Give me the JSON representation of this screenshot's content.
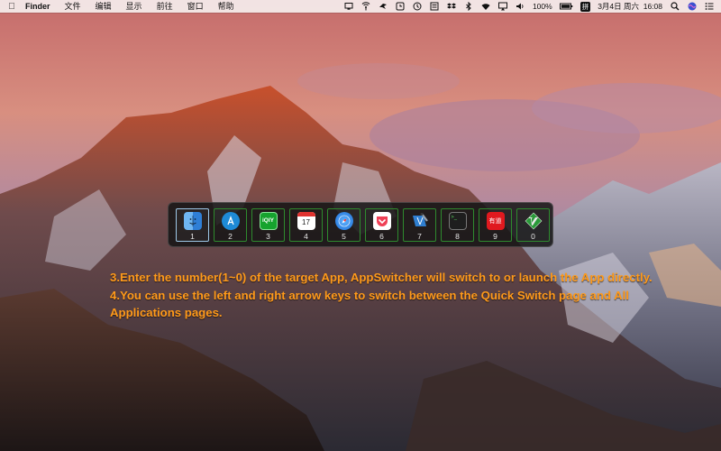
{
  "menubar": {
    "apple_icon": "apple-logo-icon",
    "app_name": "Finder",
    "menus": [
      "文件",
      "编辑",
      "显示",
      "前往",
      "窗口",
      "帮助"
    ],
    "status_icons": [
      "monitor-icon",
      "wifi-broadcast-icon",
      "bird-icon",
      "clock-icon",
      "timemachine-icon",
      "screen-icon",
      "dropbox-icon",
      "bluetooth-icon",
      "wifi-icon",
      "airplay-icon",
      "volume-icon"
    ],
    "battery_percent": "100%",
    "input_method": "拼",
    "datetime": "3月4日 周六  16:08",
    "search_icon": "search-icon",
    "user_icon": "siri-icon",
    "list_icon": "notification-list-icon"
  },
  "switcher": {
    "slots": [
      {
        "num": "1",
        "icon": "finder-icon",
        "bg": "#3b87d8",
        "selected": true
      },
      {
        "num": "2",
        "icon": "appstore-icon",
        "bg": "#1e8ad6"
      },
      {
        "num": "3",
        "icon": "iqiyi-icon",
        "bg": "#16a32e",
        "label": "iQIY"
      },
      {
        "num": "4",
        "icon": "calendar-icon",
        "bg": "#ffffff",
        "label": "17"
      },
      {
        "num": "5",
        "icon": "safari-icon",
        "bg": "#1d7ee0"
      },
      {
        "num": "6",
        "icon": "pocket-icon",
        "bg": "#ef4056"
      },
      {
        "num": "7",
        "icon": "xcode-icon",
        "bg": "#2f7fd1"
      },
      {
        "num": "8",
        "icon": "terminal-icon",
        "bg": "#1e1e1e"
      },
      {
        "num": "9",
        "icon": "youdao-icon",
        "bg": "#e0191f",
        "label": "有道"
      },
      {
        "num": "0",
        "icon": "vim-icon",
        "bg": "#2a9a3a"
      }
    ]
  },
  "instructions": {
    "line1": "3.Enter the number(1~0) of the target App, AppSwitcher will switch to or launch the App directly.",
    "line2": "4.You can use the left and right arrow keys to switch between the Quick Switch page and All Applications pages."
  },
  "colors": {
    "instruction_text": "#ff9a1a",
    "slot_border": "#2e8b2e",
    "selected_border": "#9ec9e8"
  }
}
